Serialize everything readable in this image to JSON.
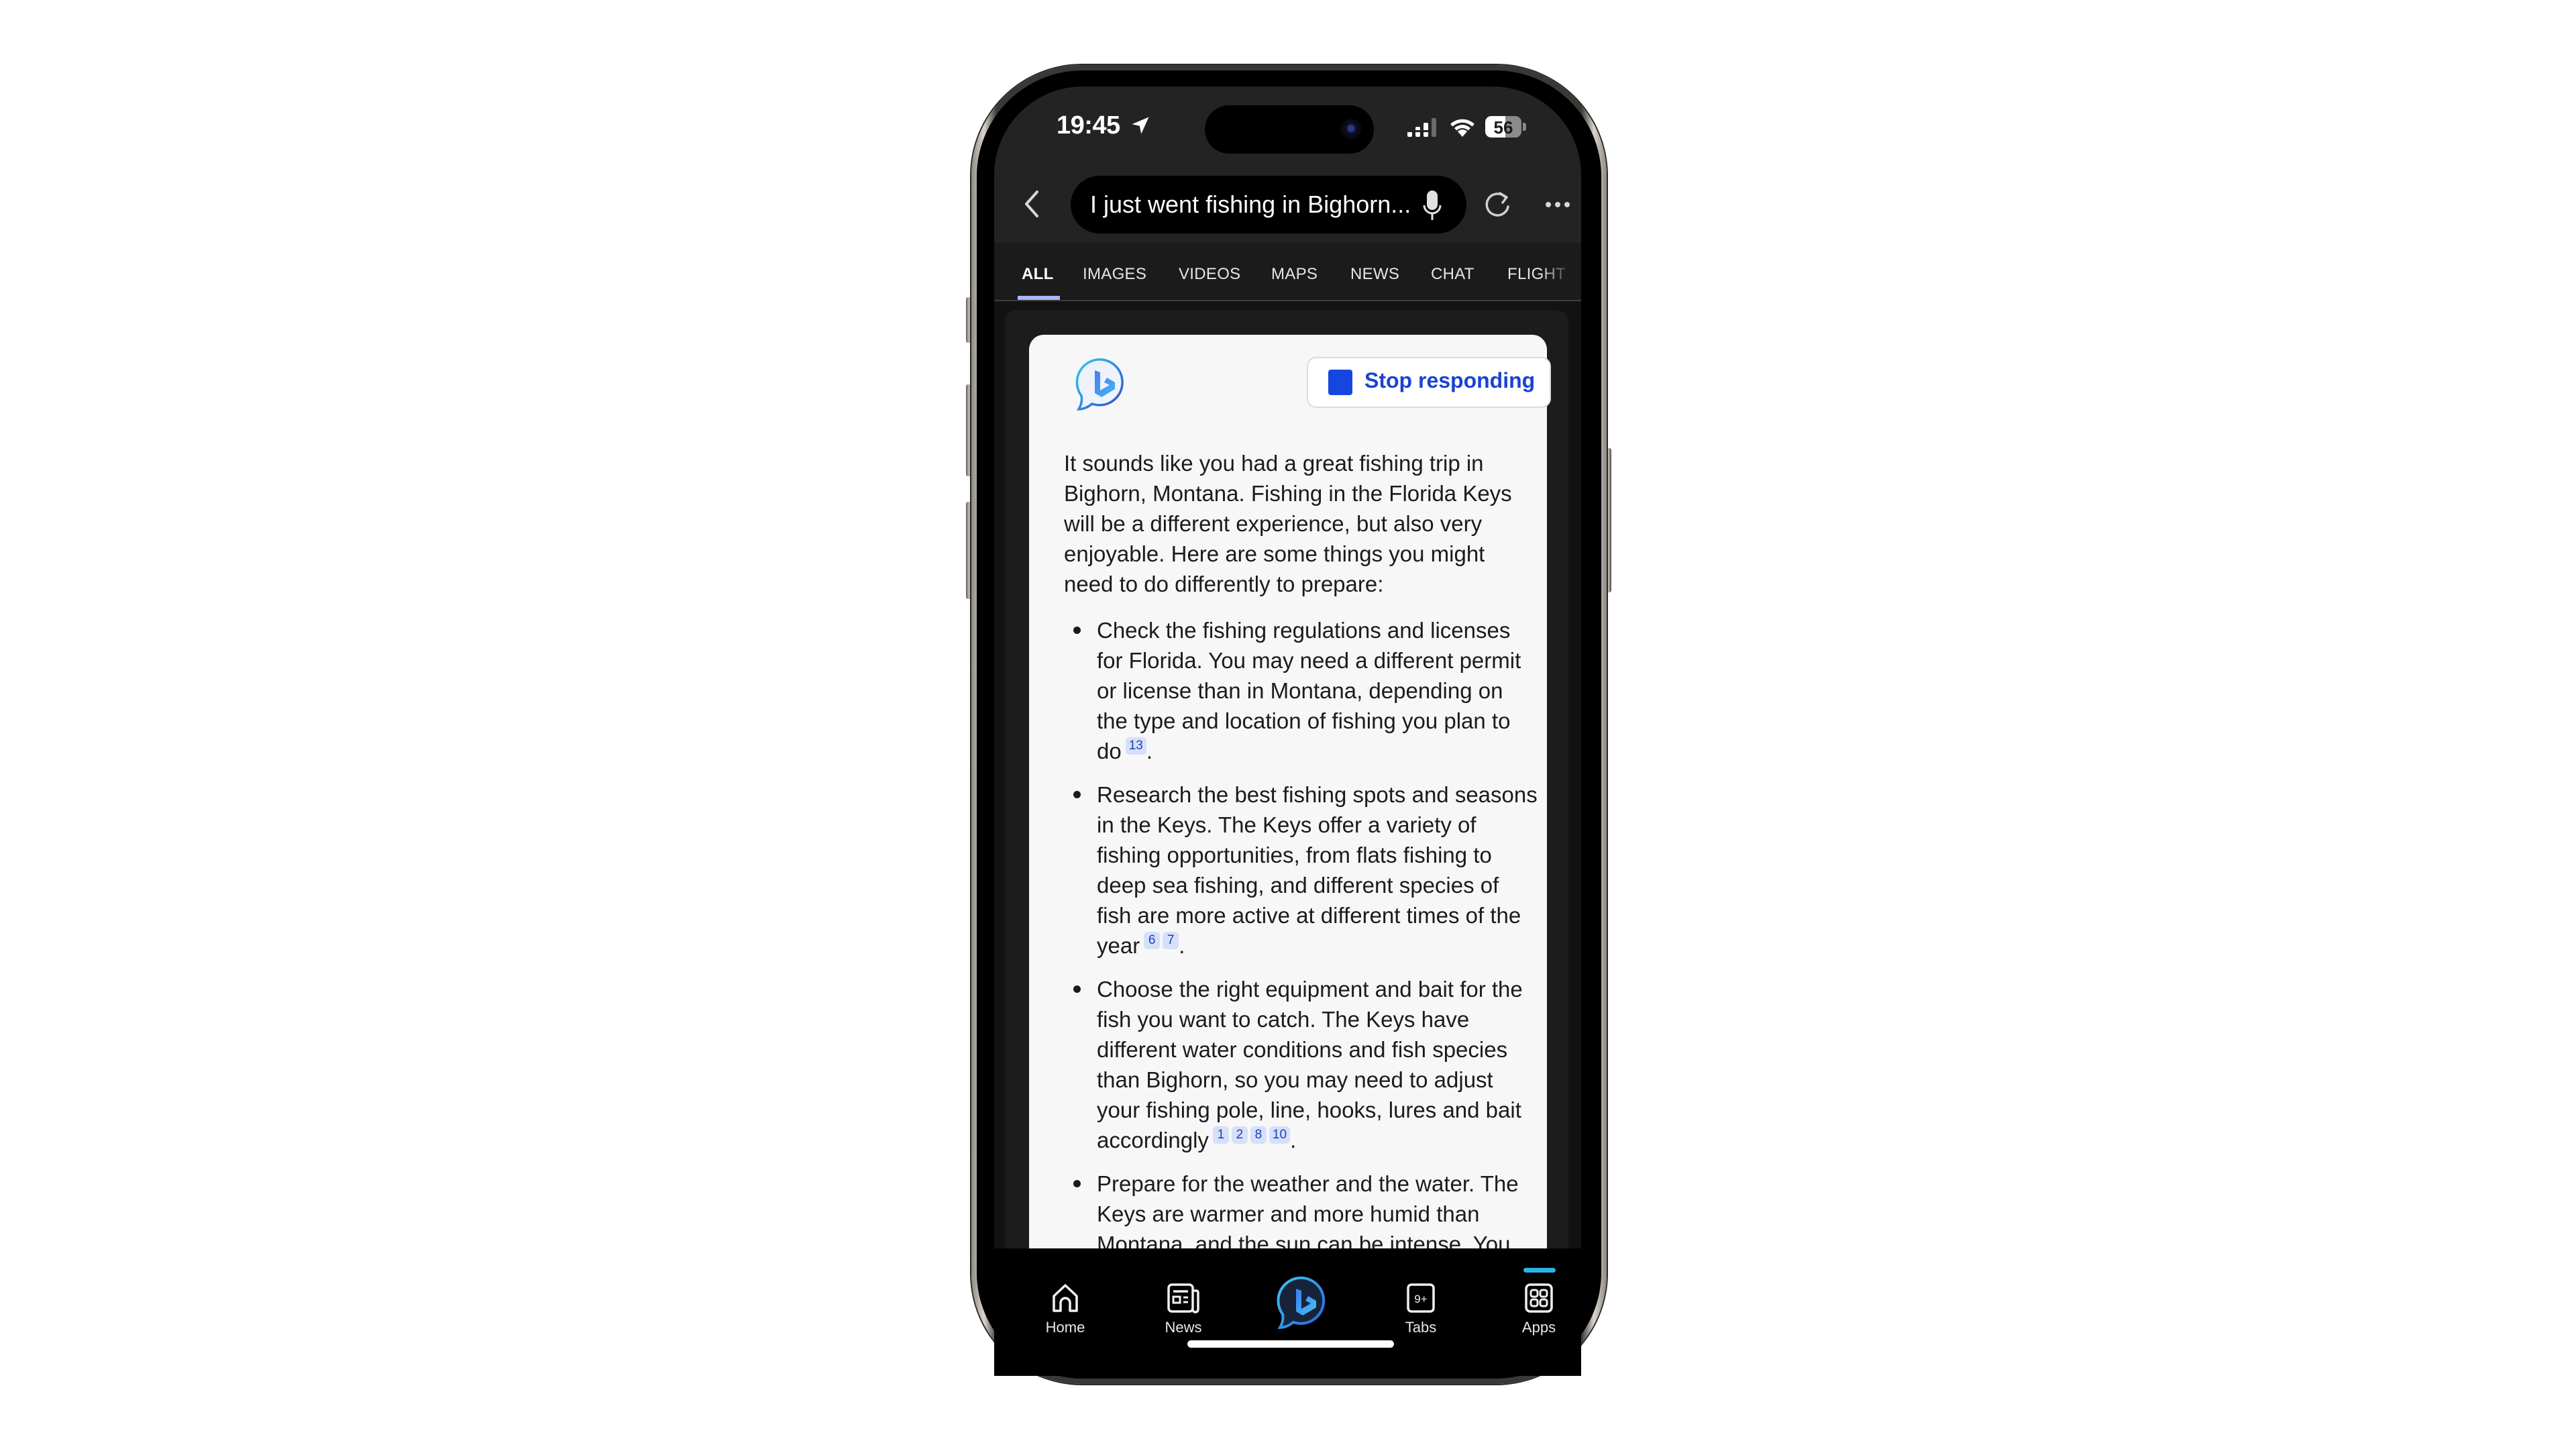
{
  "status_bar": {
    "time": "19:45",
    "battery_level": "56",
    "battery_fraction": 0.56,
    "icons": [
      "location-arrow-icon",
      "signal-icon",
      "wifi-icon",
      "battery-icon"
    ]
  },
  "address_bar": {
    "query": "I just went fishing in Bighorn...",
    "icons": {
      "back": "chevron-left-icon",
      "mic": "microphone-icon",
      "reload": "reload-icon",
      "more": "more-icon"
    }
  },
  "tabs": [
    {
      "label": "ALL",
      "active": true
    },
    {
      "label": "IMAGES",
      "active": false
    },
    {
      "label": "VIDEOS",
      "active": false
    },
    {
      "label": "MAPS",
      "active": false
    },
    {
      "label": "NEWS",
      "active": false
    },
    {
      "label": "CHAT",
      "active": false
    },
    {
      "label": "FLIGHT",
      "active": false
    }
  ],
  "chat": {
    "stop_button_label": "Stop responding",
    "intro_lines": [
      "It sounds like you had a great fishing trip in",
      "Bighorn, Montana. Fishing in the Florida Keys",
      "will be a different experience, but also very",
      "enjoyable. Here are some things you might",
      "need to do differently to prepare:"
    ],
    "bullets": [
      {
        "lines": [
          "Check the fishing regulations and licenses",
          "for Florida. You may need a different permit",
          "or license than in Montana, depending on",
          "the type and location of fishing you plan to",
          "do"
        ],
        "citations": [
          "13"
        ],
        "end": "."
      },
      {
        "lines": [
          "Research the best fishing spots and seasons",
          "in the Keys. The Keys offer a variety of",
          "fishing opportunities, from flats fishing to",
          "deep sea fishing, and different species of",
          "fish are more active at different times of the",
          "year"
        ],
        "citations": [
          "6",
          "7"
        ],
        "end": "."
      },
      {
        "lines": [
          "Choose the right equipment and bait for the",
          "fish you want to catch. The Keys have",
          "different water conditions and fish species",
          "than Bighorn, so you may need to adjust",
          "your fishing pole, line, hooks, lures and bait",
          "accordingly"
        ],
        "citations": [
          "1",
          "2",
          "8",
          "10"
        ],
        "end": "."
      },
      {
        "lines": [
          "Prepare for the weather and the water. The",
          "Keys are warmer and more humid than",
          "Montana, and the sun can be intense. You"
        ],
        "citations": [],
        "end": ""
      }
    ]
  },
  "bottom_nav": {
    "items": [
      {
        "label": "Home",
        "icon": "home-icon"
      },
      {
        "label": "News",
        "icon": "news-icon"
      },
      {
        "label": "",
        "icon": "bing-chat-icon"
      },
      {
        "label": "Tabs",
        "icon": "tabs-icon",
        "badge": "9+"
      },
      {
        "label": "Apps",
        "icon": "apps-icon",
        "active": true
      }
    ]
  },
  "colors": {
    "accent_blue": "#1646e0",
    "tab_underline": "#a9b6f2",
    "citation_bg": "#d6e0f8",
    "apps_indicator": "#2bb3e6"
  }
}
